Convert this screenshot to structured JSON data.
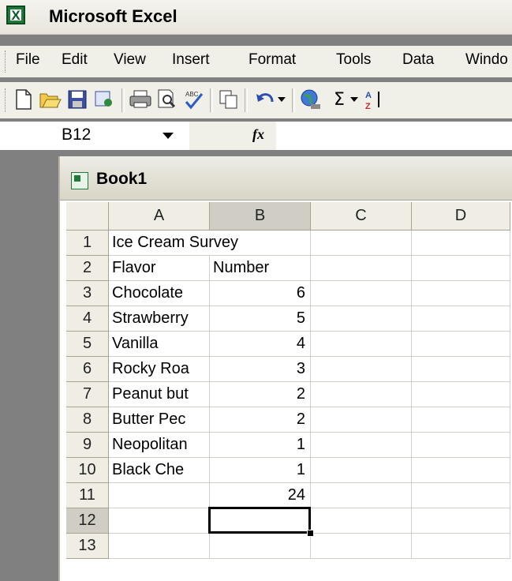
{
  "app": {
    "title": "Microsoft Excel",
    "icon": "excel-icon"
  },
  "menu": [
    {
      "label": "File"
    },
    {
      "label": "Edit"
    },
    {
      "label": "View"
    },
    {
      "label": "Insert"
    },
    {
      "label": "Format"
    },
    {
      "label": "Tools"
    },
    {
      "label": "Data"
    },
    {
      "label": "Windo"
    }
  ],
  "toolbar": {
    "icons": [
      "new-icon",
      "open-icon",
      "save-icon",
      "permission-icon",
      "print-icon",
      "print-preview-icon",
      "spelling-icon",
      "copy-icon",
      "undo-icon",
      "undo-dropdown-icon",
      "hyperlink-icon",
      "autosum-icon",
      "autosum-dropdown-icon",
      "sort-ascending-icon"
    ]
  },
  "formula_bar": {
    "name_box": "B12",
    "fx": "fx",
    "formula": ""
  },
  "workbook": {
    "title": "Book1",
    "columns": [
      "A",
      "B",
      "C",
      "D"
    ],
    "selected_column": "B",
    "selected_row": "12",
    "rows": [
      {
        "n": "1",
        "a": "Ice Cream Survey",
        "b": ""
      },
      {
        "n": "2",
        "a": "Flavor",
        "b": "Number"
      },
      {
        "n": "3",
        "a": "Chocolate",
        "b": "6"
      },
      {
        "n": "4",
        "a": "Strawberry",
        "b": "5"
      },
      {
        "n": "5",
        "a": "Vanilla",
        "b": "4"
      },
      {
        "n": "6",
        "a": "Rocky Roa",
        "b": "3"
      },
      {
        "n": "7",
        "a": "Peanut but",
        "b": "2"
      },
      {
        "n": "8",
        "a": "Butter Pec",
        "b": "2"
      },
      {
        "n": "9",
        "a": "Neopolitan",
        "b": "1"
      },
      {
        "n": "10",
        "a": "Black Che",
        "b": "1"
      },
      {
        "n": "11",
        "a": "",
        "b": "24"
      },
      {
        "n": "12",
        "a": "",
        "b": ""
      },
      {
        "n": "13",
        "a": "",
        "b": ""
      }
    ]
  }
}
